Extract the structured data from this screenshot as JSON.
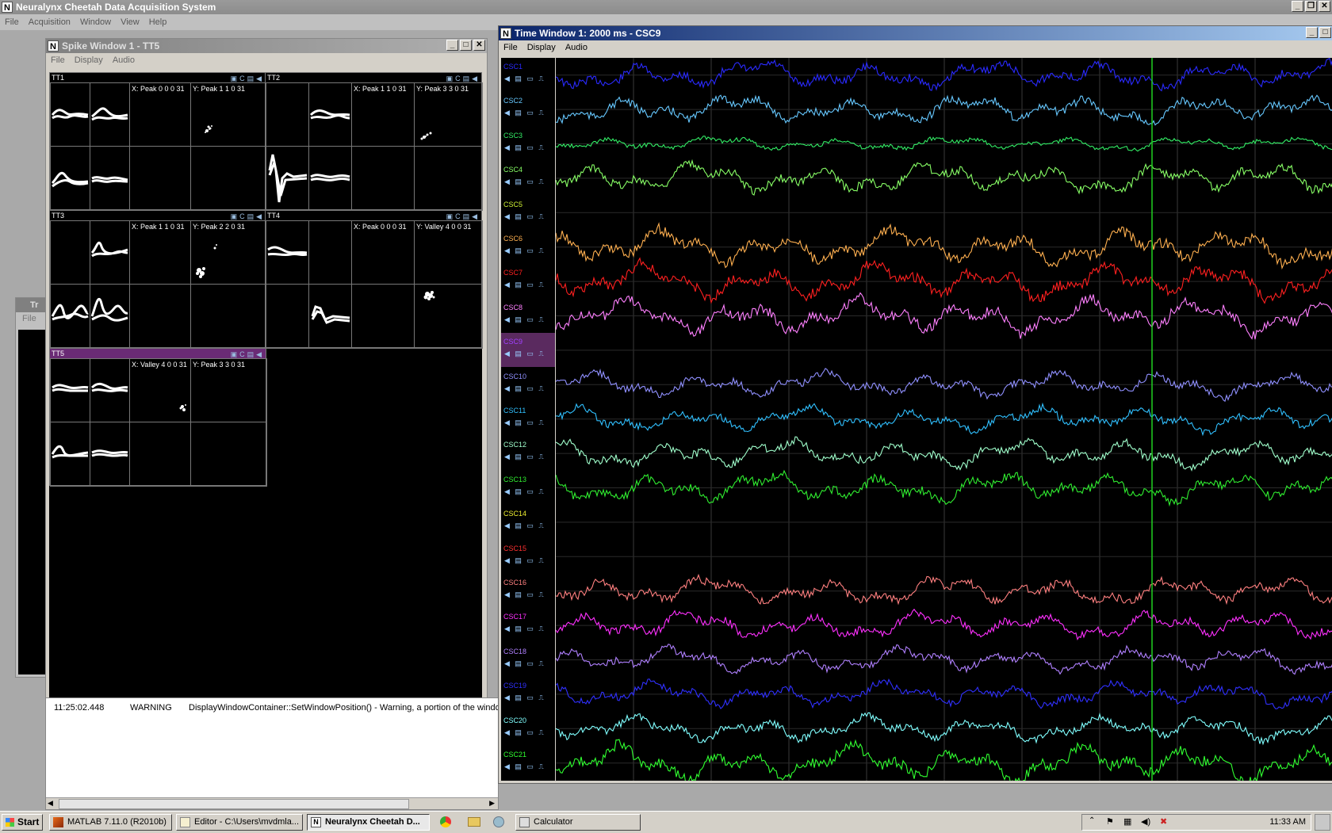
{
  "app": {
    "title": "Neuralynx Cheetah Data Acquisition System",
    "menu": [
      "File",
      "Acquisition",
      "Window",
      "View",
      "Help"
    ]
  },
  "spike_window": {
    "title": "Spike Window 1 - TT5",
    "menu": [
      "File",
      "Display",
      "Audio"
    ],
    "tetrodes": [
      {
        "name": "TT1",
        "x_label": "X: Peak 0 0 0 31",
        "y_label": "Y: Peak 1 1 0 31"
      },
      {
        "name": "TT2",
        "x_label": "X: Peak 1 1 0 31",
        "y_label": "Y: Peak 3 3 0 31"
      },
      {
        "name": "TT3",
        "x_label": "X: Peak 1 1 0 31",
        "y_label": "Y: Peak 2 2 0 31"
      },
      {
        "name": "TT4",
        "x_label": "X: Peak 0 0 0 31",
        "y_label": "Y: Valley 4 0 0 31"
      },
      {
        "name": "TT5",
        "x_label": "X: Valley 4 0 0 31",
        "y_label": "Y: Peak 3 3 0 31"
      }
    ]
  },
  "background_window": {
    "title": "Tr",
    "menu": "File"
  },
  "log": {
    "time": "11:25:02.448",
    "level": "WARNING",
    "message": "DisplayWindowContainer::SetWindowPosition() - Warning, a portion of the window"
  },
  "time_window": {
    "title": "Time Window 1: 2000 ms - CSC9",
    "menu": [
      "File",
      "Display",
      "Audio"
    ],
    "selected_channel": "CSC9",
    "channels": [
      {
        "name": "CSC1",
        "color": "#2a2aff",
        "amp": 1.0
      },
      {
        "name": "CSC2",
        "color": "#66c8ff",
        "amp": 1.0
      },
      {
        "name": "CSC3",
        "color": "#33ee66",
        "amp": 0.5
      },
      {
        "name": "CSC4",
        "color": "#88ff66",
        "amp": 1.1
      },
      {
        "name": "CSC5",
        "color": "#ccee33",
        "amp": 0
      },
      {
        "name": "CSC6",
        "color": "#ffb050",
        "amp": 1.3
      },
      {
        "name": "CSC7",
        "color": "#ff2020",
        "amp": 1.3
      },
      {
        "name": "CSC8",
        "color": "#ff80ff",
        "amp": 1.3
      },
      {
        "name": "CSC9",
        "color": "#a040ff",
        "amp": 0
      },
      {
        "name": "CSC10",
        "color": "#9090ff",
        "amp": 0.9
      },
      {
        "name": "CSC11",
        "color": "#30c0ff",
        "amp": 0.9
      },
      {
        "name": "CSC12",
        "color": "#a0ffcc",
        "amp": 1.0
      },
      {
        "name": "CSC13",
        "color": "#30ee30",
        "amp": 1.1
      },
      {
        "name": "CSC14",
        "color": "#eeee30",
        "amp": 0
      },
      {
        "name": "CSC15",
        "color": "#ff3030",
        "amp": 0
      },
      {
        "name": "CSC16",
        "color": "#ff8080",
        "amp": 1.0
      },
      {
        "name": "CSC17",
        "color": "#ff30ff",
        "amp": 1.0
      },
      {
        "name": "CSC18",
        "color": "#b080ff",
        "amp": 0.9
      },
      {
        "name": "CSC19",
        "color": "#3030ff",
        "amp": 0.9
      },
      {
        "name": "CSC20",
        "color": "#80ffff",
        "amp": 0.9
      },
      {
        "name": "CSC21",
        "color": "#30ff30",
        "amp": 1.3
      }
    ]
  },
  "taskbar": {
    "start": "Start",
    "tasks": [
      "MATLAB  7.11.0 (R2010b)",
      "Editor - C:\\Users\\mvdmla...",
      "Neuralynx Cheetah D...",
      "Calculator"
    ],
    "clock": "11:33 AM"
  }
}
